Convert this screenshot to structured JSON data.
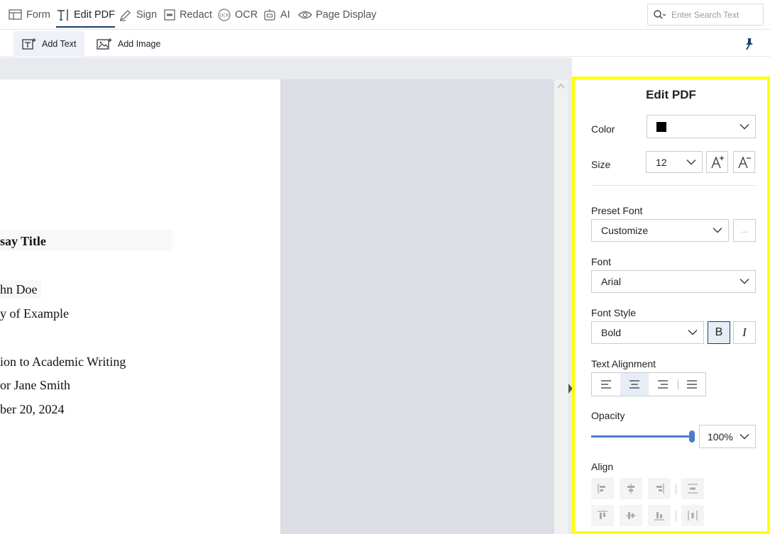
{
  "toolbar": {
    "items": [
      {
        "label": "Form"
      },
      {
        "label": "Edit PDF"
      },
      {
        "label": "Sign"
      },
      {
        "label": "Redact"
      },
      {
        "label": "OCR"
      },
      {
        "label": "AI"
      },
      {
        "label": "Page Display"
      }
    ],
    "active": "Edit PDF",
    "search_placeholder": "Enter Search Text"
  },
  "subtoolbar": {
    "add_text": "Add Text",
    "add_image": "Add Image"
  },
  "document": {
    "lines": [
      "say Title",
      "hn Doe",
      "y of Example",
      "ion to Academic Writing",
      "or Jane Smith",
      "ber 20, 2024"
    ]
  },
  "panel": {
    "title": "Edit PDF",
    "color_label": "Color",
    "color_value": "#000000",
    "size_label": "Size",
    "size_value": "12",
    "preset_font_label": "Preset Font",
    "preset_font_value": "Customize",
    "more_label": "...",
    "font_label": "Font",
    "font_value": "Arial",
    "font_style_label": "Font Style",
    "font_style_value": "Bold",
    "bold_label": "B",
    "italic_label": "I",
    "text_alignment_label": "Text Alignment",
    "text_alignment_selected": "center",
    "opacity_label": "Opacity",
    "opacity_percent": 100,
    "opacity_value": "100%",
    "align_label": "Align"
  },
  "colors": {
    "accent": "#1a3f6d",
    "highlight_border": "#ffff00",
    "slider": "#4a7cc9"
  }
}
